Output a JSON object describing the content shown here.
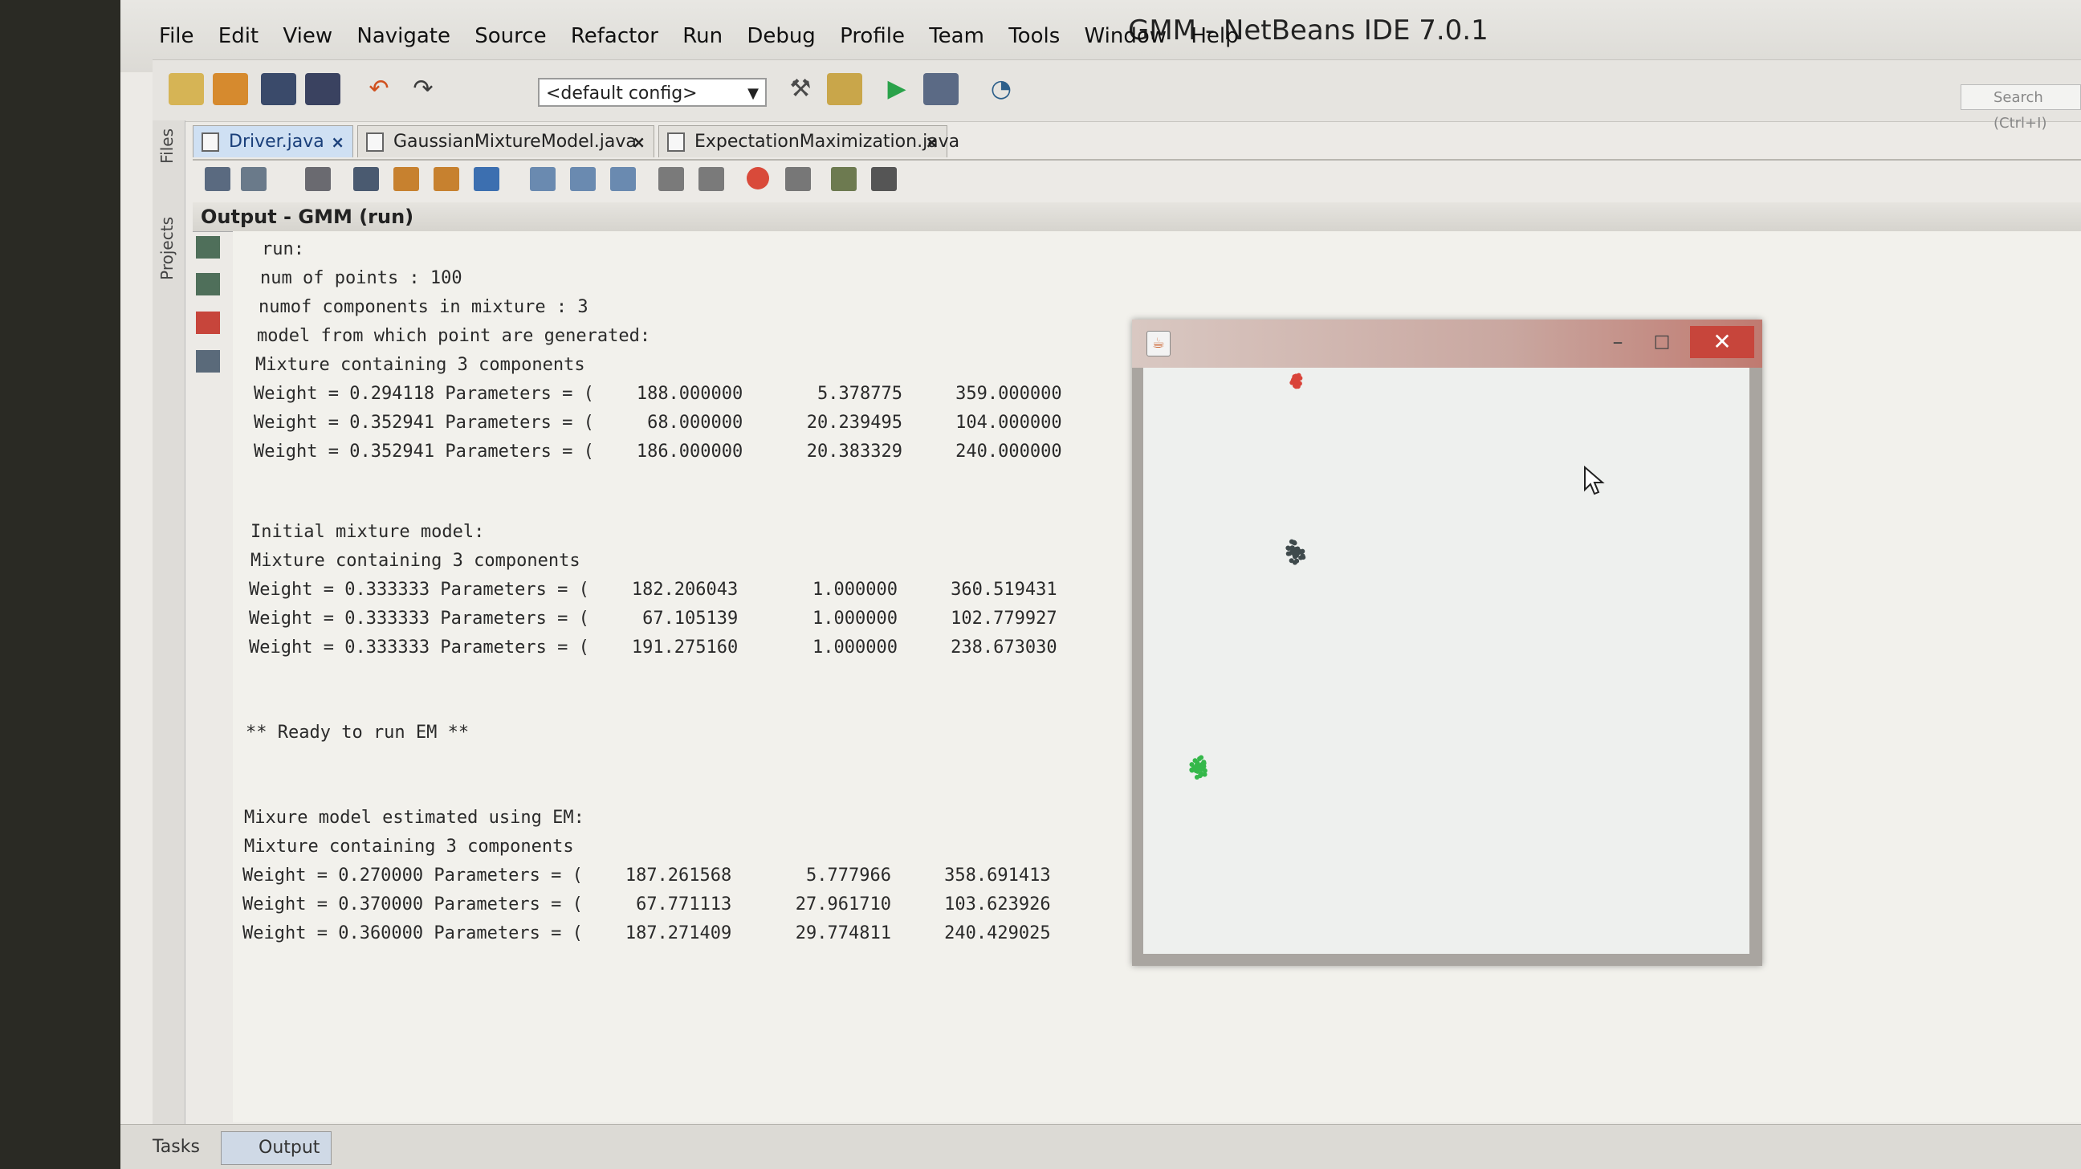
{
  "window": {
    "title": "GMM - NetBeans IDE 7.0.1"
  },
  "menu": [
    "File",
    "Edit",
    "View",
    "Navigate",
    "Source",
    "Refactor",
    "Run",
    "Debug",
    "Profile",
    "Team",
    "Tools",
    "Window",
    "Help"
  ],
  "toolbar": {
    "config_value": "<default config>",
    "search_placeholder": "Search (Ctrl+I)"
  },
  "side_tabs": {
    "files": "Files",
    "projects": "Projects"
  },
  "editor_tabs": [
    {
      "label": "Driver.java",
      "active": true
    },
    {
      "label": "GaussianMixtureModel.java",
      "active": false
    },
    {
      "label": "ExpectationMaximization.java",
      "active": false
    }
  ],
  "output": {
    "title": "Output - GMM (run)",
    "lines": [
      "run:",
      "num of points : 100",
      "numof components in mixture : 3",
      "model from which point are generated:",
      "Mixture containing 3 components",
      "Weight = 0.294118 Parameters = (    188.000000       5.378775     359.000000",
      "Weight = 0.352941 Parameters = (     68.000000      20.239495     104.000000",
      "Weight = 0.352941 Parameters = (    186.000000      20.383329     240.000000",
      "",
      "Initial mixture model:",
      "Mixture containing 3 components",
      "Weight = 0.333333 Parameters = (    182.206043       1.000000     360.519431",
      "Weight = 0.333333 Parameters = (     67.105139       1.000000     102.779927",
      "Weight = 0.333333 Parameters = (    191.275160       1.000000     238.673030",
      "",
      "** Ready to run EM **",
      "",
      "Mixure model estimated using EM:",
      "Mixture containing 3 components",
      "Weight = 0.270000 Parameters = (    187.261568       5.777966     358.691413",
      "Weight = 0.370000 Parameters = (     67.771113      27.961710     103.623926",
      "Weight = 0.360000 Parameters = (    187.271409      29.774811     240.429025"
    ]
  },
  "bottom_tabs": {
    "tasks": "Tasks",
    "output": "Output"
  },
  "java_window": {
    "title_bar_color": "#c07a70",
    "close_label": "✕",
    "minimize_label": "–",
    "maximize_label": "□",
    "clusters": [
      {
        "color": "#d9443a"
      },
      {
        "color": "#3f4a4c"
      },
      {
        "color": "#35b84a"
      }
    ]
  }
}
